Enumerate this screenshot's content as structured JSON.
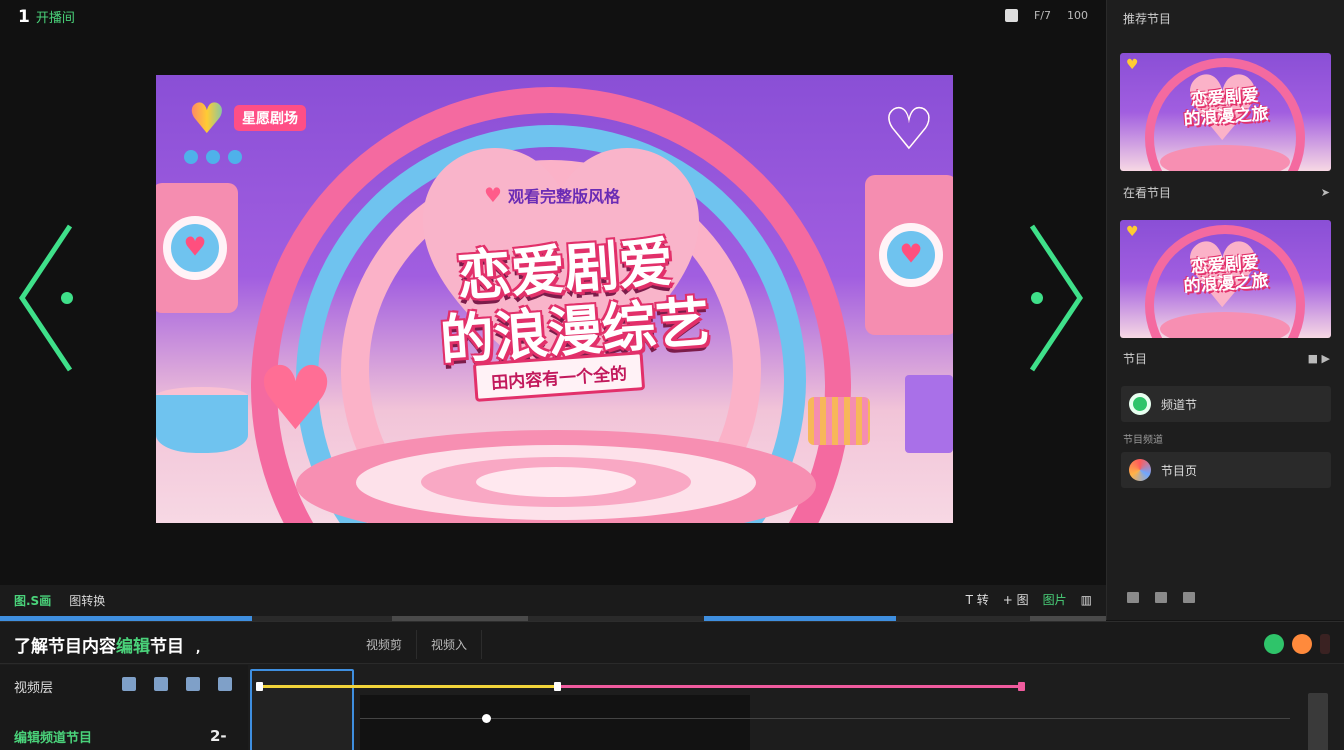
{
  "header": {
    "number": "1",
    "title": "开播间",
    "zoom": "100",
    "fit_label": "F/7"
  },
  "stage": {
    "brand_tag": "星愿剧场",
    "sub_tag": "观看完整版风格",
    "title_line1": "恋爱剧爱",
    "title_line2": "的浪漫综艺",
    "ribbon": "田内容有一个全的"
  },
  "right_panel": {
    "title": "推荐节目",
    "thumb1_text": "恋爱剧爱\n的浪漫之旅",
    "thumb2_text": "恋爱剧爱\n的浪漫之旅",
    "row1_label": "在看节目",
    "row2_label": "节目",
    "card1_label": "频道节",
    "small_label": "节目频道",
    "card2_label": "节目页"
  },
  "control_bar": {
    "left_active": "图.S画",
    "left_item2": "图转换",
    "right_items": [
      "T 转",
      "+ 图",
      "图片"
    ]
  },
  "timeline": {
    "title_part1": "了解节目内容",
    "title_highlight": "编辑",
    "title_part2": "节目",
    "title_suffix": ",",
    "tabs": [
      "视频剪",
      "视频入"
    ],
    "track_label": "视频层",
    "track2_label": "编辑频道节目",
    "track2_count": "2-"
  },
  "colors": {
    "accent_green": "#4ad27a",
    "keyframe_yellow": "#f2d43a",
    "keyframe_pink": "#f05b9e",
    "selection_blue": "#3f8fe0"
  }
}
